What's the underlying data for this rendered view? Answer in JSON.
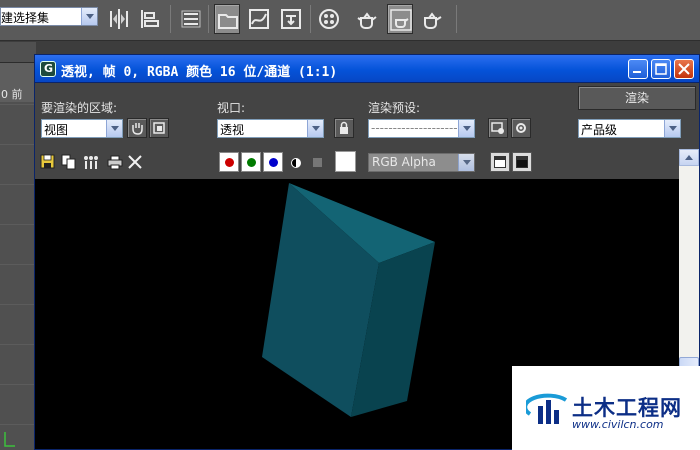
{
  "toolbar": {
    "selection_set_value": "建选择集",
    "active_buttons": [
      "render-setup",
      "render-frame-window",
      "render-production"
    ]
  },
  "left_viewport": {
    "label": "0 前"
  },
  "render_window": {
    "title": "透视, 帧 0, RGBA 颜色 16 位/通道 (1:1)",
    "area_label": "要渲染的区域:",
    "area_value": "视图",
    "viewport_label": "视口:",
    "viewport_value": "透视",
    "preset_label": "渲染预设:",
    "preset_value": "--------------------",
    "render_button": "渲染",
    "quality_value": "产品级",
    "channel_value": "RGB Alpha",
    "channel_colors": {
      "red": "#cc0000",
      "green": "#007a00",
      "blue": "#0000cc"
    },
    "canvas_background": "#000000",
    "object_colors": {
      "front": "#0f4e5e",
      "side": "#09434f",
      "top": "#136474"
    }
  },
  "watermark": {
    "brand": "土木工程网",
    "url": "www.civilcn.com"
  },
  "colors": {
    "titlebar": "#0553d9",
    "panel": "#444444",
    "toolbar": "#5a5a5a"
  }
}
